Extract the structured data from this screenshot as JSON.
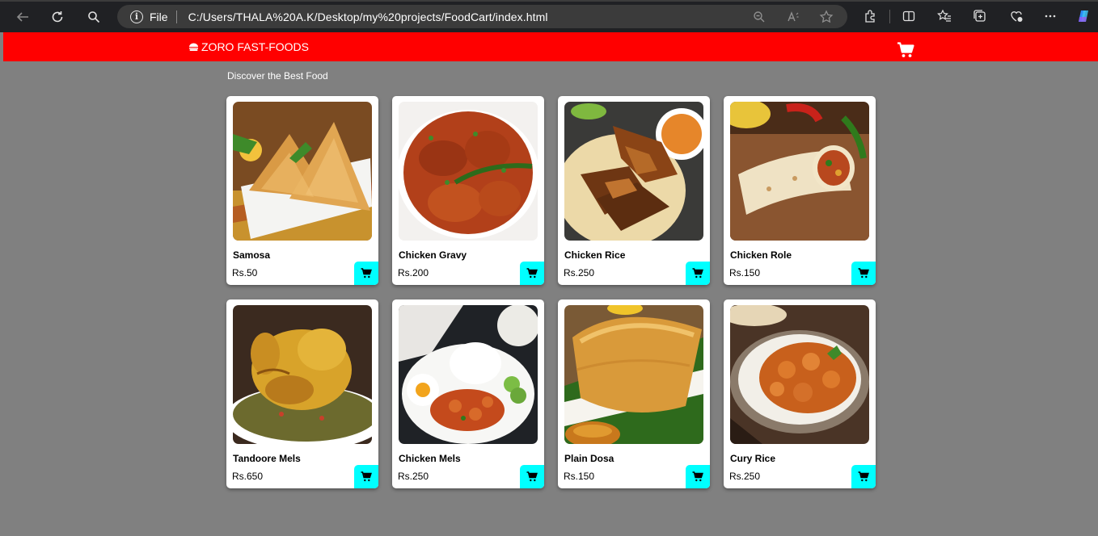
{
  "browser": {
    "file_label": "File",
    "url": "C:/Users/THALA%20A.K/Desktop/my%20projects/FoodCart/index.html"
  },
  "header": {
    "brand": "ZORO FAST-FOODS",
    "cart_icon": "cart-icon",
    "background_color": "#ff0000"
  },
  "section": {
    "subtitle": "Discover the Best Food"
  },
  "products": [
    {
      "name": "Samosa",
      "price": "Rs.50"
    },
    {
      "name": "Chicken Gravy",
      "price": "Rs.200"
    },
    {
      "name": "Chicken Rice",
      "price": "Rs.250"
    },
    {
      "name": "Chicken Role",
      "price": "Rs.150"
    },
    {
      "name": "Tandoore Mels",
      "price": "Rs.650"
    },
    {
      "name": "Chicken Mels",
      "price": "Rs.250"
    },
    {
      "name": "Plain Dosa",
      "price": "Rs.150"
    },
    {
      "name": "Cury Rice",
      "price": "Rs.250"
    }
  ],
  "colors": {
    "accent_button": "#00ffff",
    "page_background": "#808080"
  }
}
